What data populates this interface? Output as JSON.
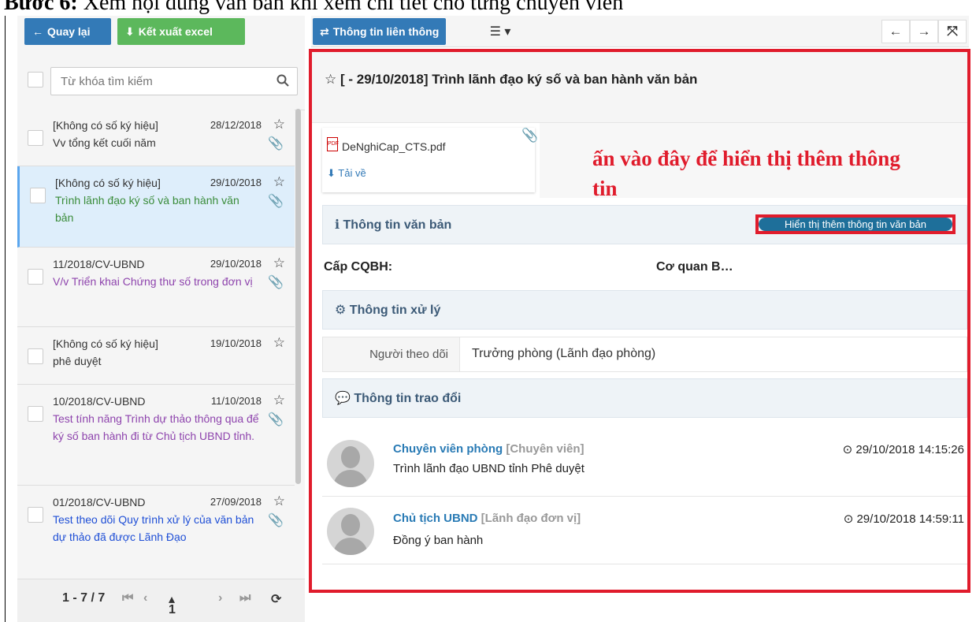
{
  "doc": {
    "heading_prefix": "Bước 6:",
    "heading_rest": " Xem nội dung văn bản khi xem chi tiết cho từng chuyên viên"
  },
  "toolbar": {
    "back_label": "Quay lại",
    "export_label": "Kết xuất excel"
  },
  "search": {
    "placeholder": "Từ khóa tìm kiếm"
  },
  "list": [
    {
      "code": "[Không có số ký hiệu]",
      "date": "28/12/2018",
      "title": "Vv tổng kết cuối năm",
      "color": "#333333",
      "clip": true
    },
    {
      "code": "[Không có số ký hiệu]",
      "date": "29/10/2018",
      "title": "Trình lãnh đạo ký số và ban hành văn bản",
      "color": "#3a8c3a",
      "clip": true
    },
    {
      "code": "11/2018/CV-UBND",
      "date": "29/10/2018",
      "title": "V/v Triển khai Chứng thư số trong đơn vị",
      "color": "#8e44ad",
      "clip": true
    },
    {
      "code": "[Không có số ký hiệu]",
      "date": "19/10/2018",
      "title": "phê duyệt",
      "color": "#333333",
      "clip": false
    },
    {
      "code": "10/2018/CV-UBND",
      "date": "11/10/2018",
      "title": "Test tính năng Trình dự thảo thông qua để ký số ban hành đi từ Chủ tịch UBND tỉnh.",
      "color": "#8e44ad",
      "clip": true
    },
    {
      "code": "01/2018/CV-UBND",
      "date": "27/09/2018",
      "title": "Test theo dõi Quy trình xử lý của văn bản dự thảo đã được Lãnh Đạo",
      "color": "#1f4fd6",
      "clip": true
    }
  ],
  "pager": {
    "range": "1 - 7 / 7",
    "page": "1"
  },
  "top": {
    "tab_label": "Thông tin liên thông"
  },
  "detail": {
    "title": "[ - 29/10/2018] Trình lãnh đạo ký số và ban hành văn bản",
    "attachment": {
      "name": "DeNghiCap_CTS.pdf",
      "download": "Tải về"
    },
    "note": "ấn vào đây để hiển thị thêm thông tin",
    "section_doc": "Thông tin văn bản",
    "show_more": "Hiển thị thêm thông tin văn bản",
    "cap_label": "Cấp CQBH:",
    "cap_value": "Cơ quan B…",
    "section_process": "Thông tin xử lý",
    "follower_label": "Người theo dõi",
    "follower_value": "Trưởng phòng (Lãnh đạo phòng)",
    "section_exchange": "Thông tin trao đổi",
    "comments": [
      {
        "name": "Chuyên viên phòng",
        "role": "[Chuyên viên]",
        "text": "Trình lãnh đạo UBND tỉnh Phê duyệt",
        "time": "29/10/2018 14:15:26"
      },
      {
        "name": "Chủ tịch UBND",
        "role": "[Lãnh đạo đơn vị]",
        "text": "Đồng ý ban hành",
        "time": "29/10/2018 14:59:11"
      }
    ]
  },
  "colors": {
    "primary": "#337ab7",
    "success": "#5cb85c",
    "highlight": "#e01c2c"
  }
}
